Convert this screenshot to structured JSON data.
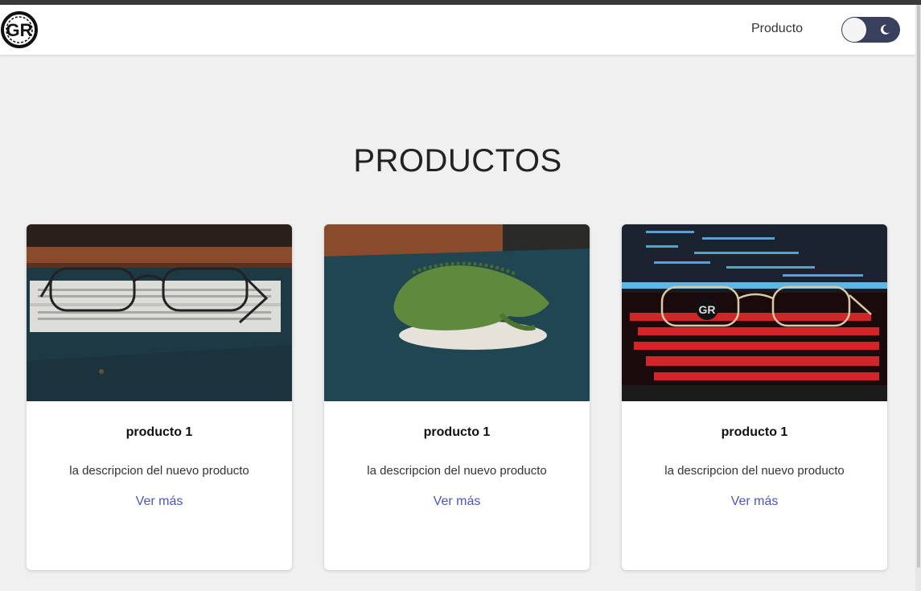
{
  "navbar": {
    "logo_text": "GR",
    "link_label": "Producto",
    "toggle_icon": "moon-icon",
    "toggle_color": "#38405e"
  },
  "main": {
    "heading": "PRODUCTOS"
  },
  "cards": [
    {
      "title": "producto 1",
      "description": "la descripcion del nuevo producto",
      "link": "Ver más",
      "image": "eyeglasses-on-breadboard"
    },
    {
      "title": "producto 1",
      "description": "la descripcion del nuevo producto",
      "link": "Ver más",
      "image": "green-lizard-figurine"
    },
    {
      "title": "producto 1",
      "description": "la descripcion del nuevo producto",
      "link": "Ver más",
      "image": "eyeglasses-on-red-keyboard"
    }
  ],
  "colors": {
    "link": "#4a55c8",
    "background": "#f0f0f0"
  }
}
